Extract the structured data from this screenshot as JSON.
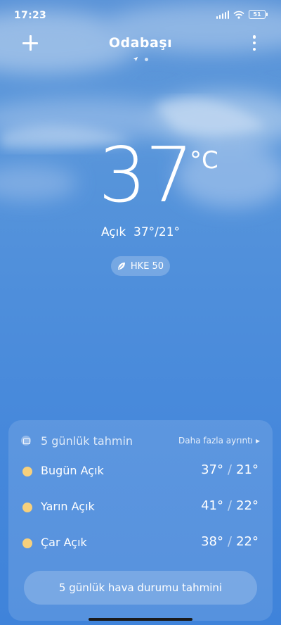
{
  "status": {
    "time": "17:23",
    "battery": "51"
  },
  "header": {
    "city": "Odabaşı"
  },
  "current": {
    "temp": "37",
    "unit": "°C",
    "condition": "Açık",
    "high": "37°",
    "low": "21°",
    "aqi_label": "HKE 50"
  },
  "forecast": {
    "title": "5 günlük tahmin",
    "more_label": "Daha fazla ayrıntı",
    "days": [
      {
        "label": "Bugün Açık",
        "high": "37°",
        "low": "21°"
      },
      {
        "label": "Yarın Açık",
        "high": "41°",
        "low": "22°"
      },
      {
        "label": "Çar Açık",
        "high": "38°",
        "low": "22°"
      }
    ],
    "button_label": "5 günlük hava durumu tahmini"
  },
  "colors": {
    "sun": "#f7d07c",
    "sky_top": "#5a93d8",
    "sky_bottom": "#3f83da"
  },
  "icons": [
    "add-icon",
    "more-vert-icon",
    "location-arrow-icon",
    "leaf-icon",
    "calendar-icon",
    "sun-icon",
    "wifi-icon",
    "signal-icon",
    "battery-icon"
  ]
}
